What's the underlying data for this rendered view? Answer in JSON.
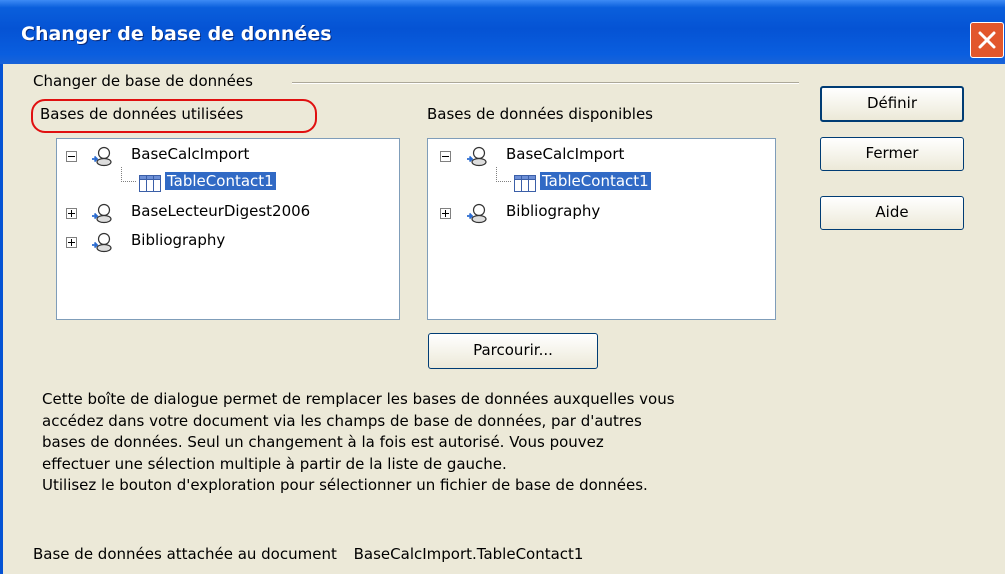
{
  "window": {
    "title": "Changer de base de données"
  },
  "group": {
    "label": "Changer de base de données"
  },
  "used_panel": {
    "label": "Bases de données utilisées",
    "items": [
      {
        "label": "BaseCalcImport",
        "expanded": true,
        "icon": "database-icon"
      },
      {
        "label": "TableContact1",
        "selected": true,
        "icon": "table-icon"
      },
      {
        "label": "BaseLecteurDigest2006",
        "expanded": false,
        "icon": "database-icon"
      },
      {
        "label": "Bibliography",
        "expanded": false,
        "icon": "database-icon"
      }
    ]
  },
  "available_panel": {
    "label": "Bases de données disponibles",
    "items": [
      {
        "label": "BaseCalcImport",
        "expanded": true,
        "icon": "database-icon"
      },
      {
        "label": "TableContact1",
        "selected": true,
        "icon": "table-icon"
      },
      {
        "label": "Bibliography",
        "expanded": false,
        "icon": "database-icon"
      }
    ]
  },
  "buttons": {
    "define": "Définir",
    "close": "Fermer",
    "help": "Aide",
    "browse": "Parcourir..."
  },
  "description": [
    "Cette boîte de dialogue permet de remplacer les bases de données auxquelles vous",
    "accédez dans votre document via les champs de base de données, par d'autres",
    "bases de données. Seul un changement à la fois est autorisé. Vous pouvez",
    "effectuer une sélection multiple à partir de la liste de gauche.",
    "Utilisez le bouton d'exploration pour sélectionner un fichier de base de données."
  ],
  "attached": {
    "label": "Base de données attachée au document",
    "value": "BaseCalcImport.TableContact1"
  },
  "colors": {
    "titlebar": "#0553d4",
    "selection": "#316ac5",
    "highlight_ring": "#e01010",
    "close": "#e2572c"
  }
}
